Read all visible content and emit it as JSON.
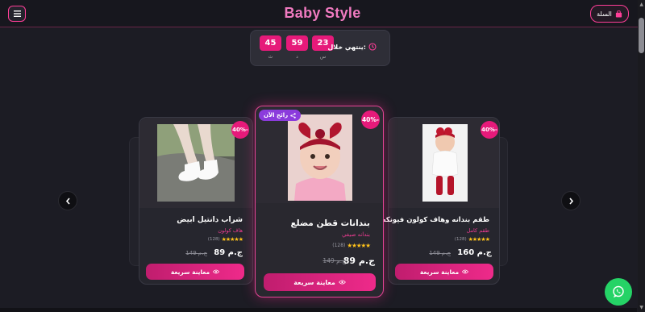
{
  "header": {
    "title": "Baby Style",
    "cart_label": "السلة"
  },
  "countdown": {
    "label": "ينتهي خلال:",
    "units": [
      {
        "value": "23",
        "unit": "س"
      },
      {
        "value": "59",
        "unit": "د"
      },
      {
        "value": "45",
        "unit": "ث"
      }
    ]
  },
  "products": {
    "left": {
      "name": "شراب دانتيل ابيض",
      "category": "هاف كولون",
      "stars": "★★★★★",
      "reviews": "(128)",
      "price": "89 ج.م",
      "old_price": "149 ج.م",
      "discount": "40%-",
      "button": "معاينة سريعة"
    },
    "center": {
      "name": "بندانات قطن مضلع",
      "category": "بندانه صيفي",
      "stars": "★★★★★",
      "reviews": "(128)",
      "price": "89 ج.م",
      "old_price": "149 ج.م",
      "discount": "40%-",
      "trending": "رائج الآن",
      "button": "معاينة سريعة"
    },
    "right": {
      "name": "طقم بندانه وهاف كولون فيونكه",
      "category": "طقم كامل",
      "stars": "★★★★★",
      "reviews": "(128)",
      "price": "160 ج.م",
      "old_price": "149 ج.م",
      "discount": "40%-",
      "button": "معاينة سريعة"
    }
  },
  "colors": {
    "accent": "#e61a7a",
    "title": "#f07ac0",
    "background": "#1c1c24",
    "whatsapp": "#25d366",
    "trending_badge": "#8b3bdc"
  },
  "icons": {
    "menu": "hamburger-icon",
    "cart": "shopping-bag-icon",
    "clock": "clock-icon",
    "prev": "chevron-left-icon",
    "next": "chevron-right-icon",
    "eye": "eye-icon",
    "whatsapp": "whatsapp-icon",
    "trend": "share-icon"
  }
}
